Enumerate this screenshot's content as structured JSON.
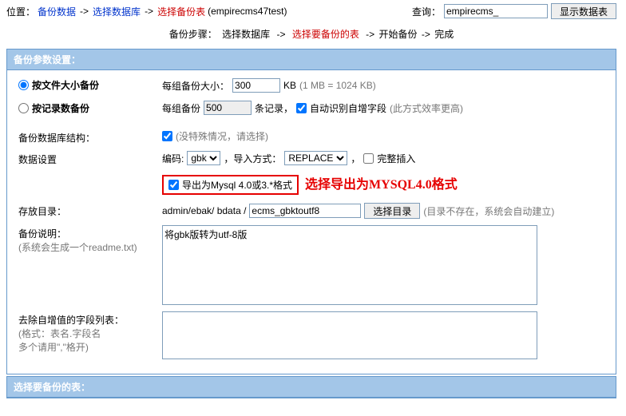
{
  "location": {
    "prefix": "位置：",
    "l1": "备份数据",
    "l2": "选择数据库",
    "l3": "选择备份表",
    "suffix": "(empirecms47test)"
  },
  "query": {
    "label": "查询：",
    "value": "empirecms_",
    "btn": "显示数据表"
  },
  "steps": {
    "prefix": "备份步骤：",
    "s1": "选择数据库",
    "s2": "选择要备份的表",
    "s3": "开始备份",
    "s4": "完成"
  },
  "panels": {
    "settings_title": "备份参数设置：",
    "tables_title": "选择要备份的表："
  },
  "radios": {
    "by_size": "按文件大小备份",
    "by_rows": "按记录数备份"
  },
  "size_row": {
    "label": "每组备份大小：",
    "value": "300",
    "unit": "KB",
    "hint": "(1 MB = 1024 KB)"
  },
  "rows_row": {
    "label": "每组备份",
    "value": "500",
    "unit": "条记录，",
    "auto_label": "自动识别自增字段",
    "hint": "(此方式效率更高)"
  },
  "struct_row": {
    "label": "备份数据库结构：",
    "hint": "(没特殊情况，请选择)"
  },
  "data_row": {
    "label": "数据设置",
    "encoding_label": "编码:",
    "encoding_value": "gbk",
    "import_label": "，导入方式：",
    "import_value": "REPLACE",
    "full_insert": "完整插入"
  },
  "export_box": {
    "label": "导出为Mysql 4.0或3.*格式",
    "annot": "选择导出为MYSQL4.0格式"
  },
  "dir_row": {
    "label": "存放目录：",
    "prefix": "admin/ebak/ bdata /",
    "value": "ecms_gbktoutf8",
    "btn": "选择目录",
    "hint": "(目录不存在，系统会自动建立)"
  },
  "desc_row": {
    "label": "备份说明：",
    "sub": "(系统会生成一个readme.txt)",
    "value": "将gbk版转为utf-8版"
  },
  "exclude_row": {
    "label": "去除自增值的字段列表：",
    "sub1": "(格式：表名.字段名",
    "sub2": "多个请用\",\"格开)",
    "value": ""
  }
}
